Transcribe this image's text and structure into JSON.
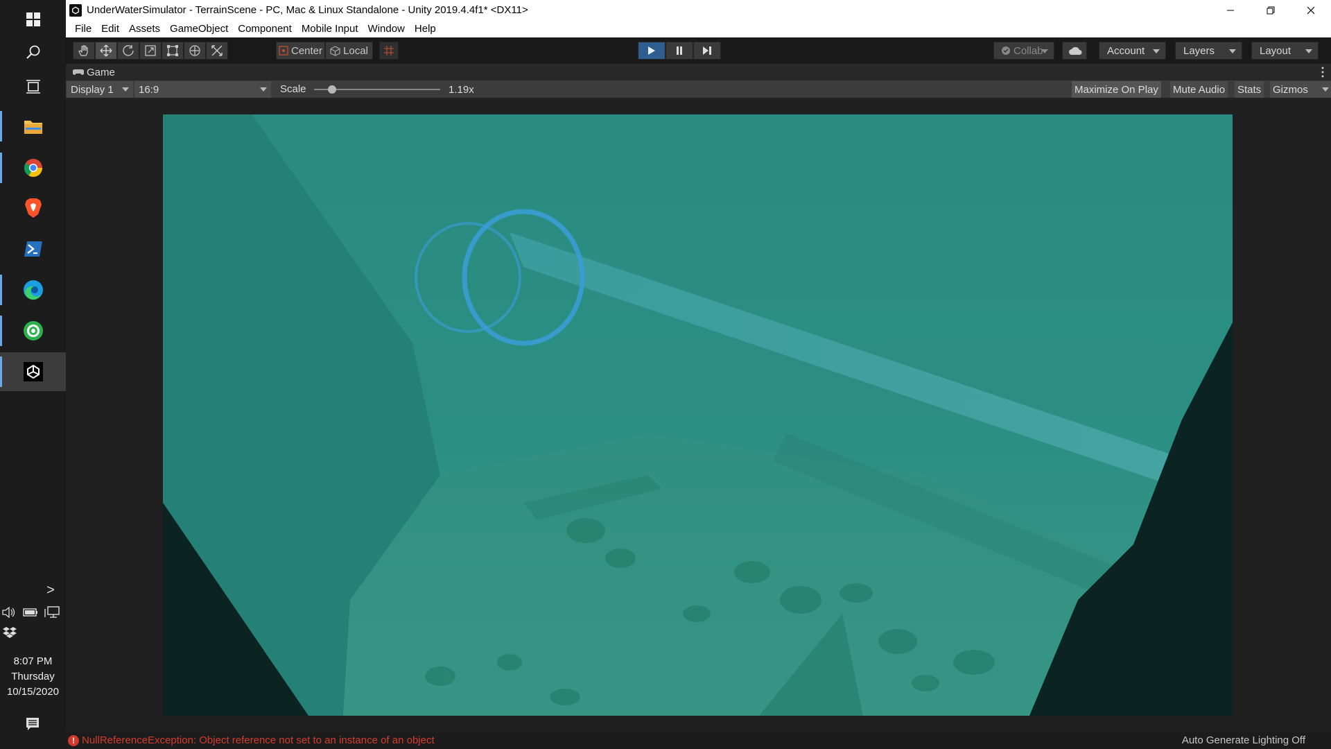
{
  "taskbar": {
    "apps": [
      "start-icon",
      "search-icon",
      "task-view-icon",
      "file-explorer-icon",
      "chrome-icon",
      "brave-icon",
      "powershell-icon",
      "edge-icon",
      "green-app-icon",
      "unity-icon"
    ],
    "expand_label": ">",
    "clock": {
      "time": "8:07 PM",
      "day": "Thursday",
      "date": "10/15/2020"
    }
  },
  "window": {
    "title": "UnderWaterSimulator - TerrainScene - PC, Mac & Linux Standalone - Unity 2019.4.4f1* <DX11>",
    "menu": [
      "File",
      "Edit",
      "Assets",
      "GameObject",
      "Component",
      "Mobile Input",
      "Window",
      "Help"
    ]
  },
  "toolbar": {
    "pivot_label": "Center",
    "space_label": "Local",
    "collab_label": "Collab",
    "account_label": "Account",
    "layers_label": "Layers",
    "layout_label": "Layout",
    "play_active": true
  },
  "game_view": {
    "tab_label": "Game",
    "display": "Display 1",
    "aspect": "16:9",
    "scale_label": "Scale",
    "scale_value": "1.19x",
    "scale_fraction": 0.12,
    "maximize_label": "Maximize On Play",
    "mute_label": "Mute Audio",
    "stats_label": "Stats",
    "gizmos_label": "Gizmos"
  },
  "status": {
    "error": "NullReferenceException: Object reference not set to an instance of an object",
    "lighting": "Auto Generate Lighting Off"
  },
  "colors": {
    "water": "#2e8b80",
    "dark_rock": "#0b2422",
    "ring": "#3a9ed8",
    "error": "#d43c2d",
    "play_active": "#2e5d8f"
  }
}
